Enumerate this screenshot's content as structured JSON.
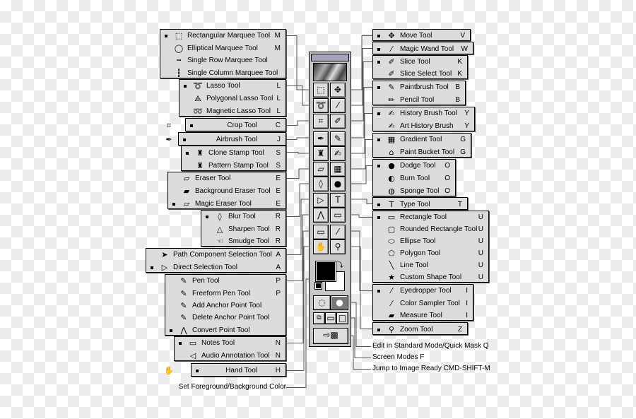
{
  "left_groups": [
    {
      "items": [
        {
          "label": "Rectangular Marquee Tool",
          "shortcut": "M",
          "icon": "rect-marquee-icon",
          "default": true
        },
        {
          "label": "Elliptical Marquee Tool",
          "shortcut": "M",
          "icon": "ellipse-marquee-icon"
        },
        {
          "label": "Single Row Marquee Tool",
          "shortcut": "",
          "icon": "single-row-marquee-icon"
        },
        {
          "label": "Single Column Marquee Tool",
          "shortcut": "",
          "icon": "single-column-marquee-icon"
        }
      ]
    },
    {
      "items": [
        {
          "label": "Lasso Tool",
          "shortcut": "L",
          "icon": "lasso-icon",
          "default": true
        },
        {
          "label": "Polygonal Lasso Tool",
          "shortcut": "L",
          "icon": "polygonal-lasso-icon"
        },
        {
          "label": "Magnetic Lasso Tool",
          "shortcut": "L",
          "icon": "magnetic-lasso-icon"
        }
      ]
    },
    {
      "items": [
        {
          "label": "Crop Tool",
          "shortcut": "C",
          "icon": "crop-icon",
          "default": true
        }
      ]
    },
    {
      "items": [
        {
          "label": "Airbrush Tool",
          "shortcut": "J",
          "icon": "airbrush-icon",
          "default": true
        }
      ]
    },
    {
      "items": [
        {
          "label": "Clone Stamp Tool",
          "shortcut": "S",
          "icon": "clone-stamp-icon",
          "default": true
        },
        {
          "label": "Pattern Stamp Tool",
          "shortcut": "S",
          "icon": "pattern-stamp-icon"
        }
      ]
    },
    {
      "items": [
        {
          "label": "Eraser Tool",
          "shortcut": "E",
          "icon": "eraser-icon"
        },
        {
          "label": "Background Eraser Tool",
          "shortcut": "E",
          "icon": "background-eraser-icon"
        },
        {
          "label": "Magic Eraser Tool",
          "shortcut": "E",
          "icon": "magic-eraser-icon",
          "default": true
        }
      ]
    },
    {
      "items": [
        {
          "label": "Blur Tool",
          "shortcut": "R",
          "icon": "blur-icon",
          "default": true
        },
        {
          "label": "Sharpen Tool",
          "shortcut": "R",
          "icon": "sharpen-icon"
        },
        {
          "label": "Smudge Tool",
          "shortcut": "R",
          "icon": "smudge-icon"
        }
      ]
    },
    {
      "items": [
        {
          "label": "Path Component Selection Tool",
          "shortcut": "A",
          "icon": "path-selection-icon"
        },
        {
          "label": "Direct Selection Tool",
          "shortcut": "A",
          "icon": "direct-selection-icon",
          "default": true
        }
      ]
    },
    {
      "items": [
        {
          "label": "Pen Tool",
          "shortcut": "P",
          "icon": "pen-icon"
        },
        {
          "label": "Freeform Pen Tool",
          "shortcut": "P",
          "icon": "freeform-pen-icon"
        },
        {
          "label": "Add Anchor Point Tool",
          "shortcut": "",
          "icon": "add-anchor-icon"
        },
        {
          "label": "Delete Anchor Point Tool",
          "shortcut": "",
          "icon": "delete-anchor-icon"
        },
        {
          "label": "Convert Point Tool",
          "shortcut": "",
          "icon": "convert-point-icon",
          "default": true
        }
      ]
    },
    {
      "items": [
        {
          "label": "Notes Tool",
          "shortcut": "N",
          "icon": "notes-icon",
          "default": true
        },
        {
          "label": "Audio Annotation Tool",
          "shortcut": "N",
          "icon": "audio-annotation-icon"
        }
      ]
    },
    {
      "items": [
        {
          "label": "Hand Tool",
          "shortcut": "H",
          "icon": "hand-icon",
          "default": true
        }
      ]
    }
  ],
  "right_groups": [
    {
      "items": [
        {
          "label": "Move Tool",
          "shortcut": "V",
          "icon": "move-icon",
          "default": true
        }
      ]
    },
    {
      "items": [
        {
          "label": "Magic Wand Tool",
          "shortcut": "W",
          "icon": "magic-wand-icon",
          "default": true
        }
      ]
    },
    {
      "items": [
        {
          "label": "Slice Tool",
          "shortcut": "K",
          "icon": "slice-icon",
          "default": true
        },
        {
          "label": "Slice Select Tool",
          "shortcut": "K",
          "icon": "slice-select-icon"
        }
      ]
    },
    {
      "items": [
        {
          "label": "Paintbrush Tool",
          "shortcut": "B",
          "icon": "paintbrush-icon",
          "default": true
        },
        {
          "label": "Pencil Tool",
          "shortcut": "B",
          "icon": "pencil-icon"
        }
      ]
    },
    {
      "items": [
        {
          "label": "History Brush Tool",
          "shortcut": "Y",
          "icon": "history-brush-icon",
          "default": true
        },
        {
          "label": "Art History Brush",
          "shortcut": "Y",
          "icon": "art-history-brush-icon"
        }
      ]
    },
    {
      "items": [
        {
          "label": "Gradient Tool",
          "shortcut": "G",
          "icon": "gradient-icon",
          "default": true
        },
        {
          "label": "Paint Bucket Tool",
          "shortcut": "G",
          "icon": "paint-bucket-icon"
        }
      ]
    },
    {
      "items": [
        {
          "label": "Dodge Tool",
          "shortcut": "O",
          "icon": "dodge-icon",
          "default": true
        },
        {
          "label": "Burn Tool",
          "shortcut": "O",
          "icon": "burn-icon"
        },
        {
          "label": "Sponge Tool",
          "shortcut": "O",
          "icon": "sponge-icon"
        }
      ]
    },
    {
      "items": [
        {
          "label": "Type Tool",
          "shortcut": "T",
          "icon": "type-icon",
          "default": true
        }
      ]
    },
    {
      "items": [
        {
          "label": "Rectangle Tool",
          "shortcut": "U",
          "icon": "rectangle-icon",
          "default": true
        },
        {
          "label": "Rounded Rectangle Tool",
          "shortcut": "U",
          "icon": "rounded-rectangle-icon"
        },
        {
          "label": "Ellipse Tool",
          "shortcut": "U",
          "icon": "ellipse-icon"
        },
        {
          "label": "Polygon Tool",
          "shortcut": "U",
          "icon": "polygon-icon"
        },
        {
          "label": "Line Tool",
          "shortcut": "U",
          "icon": "line-icon"
        },
        {
          "label": "Custom Shape Tool",
          "shortcut": "U",
          "icon": "custom-shape-icon"
        }
      ]
    },
    {
      "items": [
        {
          "label": "Eyedropper Tool",
          "shortcut": "I",
          "icon": "eyedropper-icon",
          "default": true
        },
        {
          "label": "Color Sampler Tool",
          "shortcut": "I",
          "icon": "color-sampler-icon"
        },
        {
          "label": "Measure Tool",
          "shortcut": "I",
          "icon": "measure-icon"
        }
      ]
    },
    {
      "items": [
        {
          "label": "Zoom Tool",
          "shortcut": "Z",
          "icon": "zoom-icon",
          "default": true
        }
      ]
    }
  ],
  "left_labels": [
    {
      "label": "Set Foreground/Background Color"
    }
  ],
  "right_labels": [
    {
      "label": "Edit in Standard Mode/Quick Mask Q"
    },
    {
      "label": "Screen Modes F"
    },
    {
      "label": "Jump to Image Ready CMD-SHIFT-M"
    }
  ],
  "toolbox": {
    "tools": [
      "rect-marquee-icon",
      "move-icon",
      "lasso-icon",
      "magic-wand-icon",
      "crop-icon",
      "slice-icon",
      "airbrush-icon",
      "paintbrush-icon",
      "clone-stamp-icon",
      "history-brush-icon",
      "magic-eraser-icon",
      "gradient-icon",
      "blur-icon",
      "dodge-icon",
      "direct-selection-icon",
      "type-icon",
      "convert-point-icon",
      "rectangle-icon",
      "notes-icon",
      "eyedropper-icon",
      "hand-icon",
      "zoom-icon"
    ],
    "foreground_color": "#000000",
    "background_color": "#ffffff"
  }
}
